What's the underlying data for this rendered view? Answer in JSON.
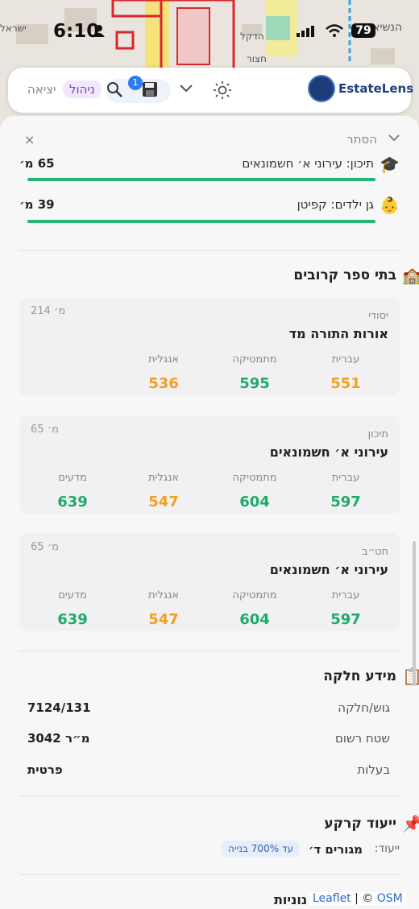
{
  "status_bar": {
    "time": "6:10",
    "battery": "79"
  },
  "map": {
    "street_labels": [
      "הנשיא",
      "הדקל",
      "חצור",
      "ישראל"
    ]
  },
  "toolbar": {
    "logo": "EstateLens",
    "search_badge": "1",
    "manage_label": "ניהול",
    "exit_label": "יציאה"
  },
  "sheet": {
    "hide_label": "הסתר",
    "close_label": "×",
    "distance_rows": [
      {
        "icon": "🎓",
        "label": "תיכון:  עירוני א׳ חשמונאים",
        "distance": "65 מ׳",
        "progress": 0.96
      },
      {
        "icon": "👶",
        "label": "גן ילדים:  קפיטן",
        "distance": "39 מ׳",
        "progress": 0.98
      }
    ],
    "schools_title": "בתי ספר קרובים",
    "schools_icon": "🏫",
    "schools": [
      {
        "level": "יסודי",
        "name": "אורות התורה מד",
        "distance": "214 מ׳",
        "scores": [
          {
            "subject": "עברית",
            "value": "551",
            "color": "orange"
          },
          {
            "subject": "מתמטיקה",
            "value": "595",
            "color": "green"
          },
          {
            "subject": "אנגלית",
            "value": "536",
            "color": "orange"
          }
        ]
      },
      {
        "level": "תיכון",
        "name": "עירוני א׳ חשמונאים",
        "distance": "65 מ׳",
        "scores": [
          {
            "subject": "עברית",
            "value": "597",
            "color": "green"
          },
          {
            "subject": "מתמטיקה",
            "value": "604",
            "color": "green"
          },
          {
            "subject": "אנגלית",
            "value": "547",
            "color": "orange"
          },
          {
            "subject": "מדעים",
            "value": "639",
            "color": "green"
          }
        ]
      },
      {
        "level": "חט״ב",
        "name": "עירוני א׳ חשמונאים",
        "distance": "65 מ׳",
        "scores": [
          {
            "subject": "עברית",
            "value": "597",
            "color": "green"
          },
          {
            "subject": "מתמטיקה",
            "value": "604",
            "color": "green"
          },
          {
            "subject": "אנגלית",
            "value": "547",
            "color": "orange"
          },
          {
            "subject": "מדעים",
            "value": "639",
            "color": "green"
          }
        ]
      }
    ],
    "parcel_title": "מידע חלקה",
    "parcel_icon": "📋",
    "parcel_rows": [
      {
        "label": "גוש/חלקה",
        "value": "7124/131"
      },
      {
        "label": "שטח רשום",
        "value": "3042 מ״ר"
      },
      {
        "label": "בעלות",
        "value": "פרטית"
      }
    ],
    "zoning_title": "ייעוד קרקע",
    "zoning_icon": "📌",
    "zoning_label": "ייעוד:",
    "zoning_value": "מגורים ד׳",
    "zoning_badge": "עד 700% בנייה",
    "bottom_title": "נוניות",
    "attribution": {
      "leaflet": "Leaflet",
      "sep": " | © ",
      "osm": "OSM"
    }
  },
  "colors": {
    "green": "#1faa6b",
    "orange": "#f0a020",
    "brand": "#1d3f7c",
    "accent": "#2b7cf0"
  }
}
